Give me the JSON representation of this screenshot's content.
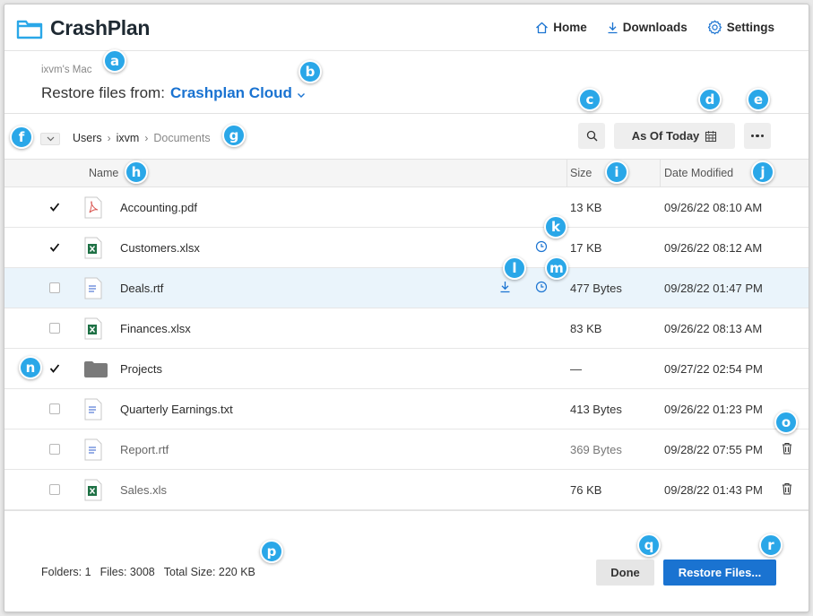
{
  "app": {
    "name": "CrashPlan"
  },
  "nav": [
    {
      "label": "Home",
      "icon": "home-icon"
    },
    {
      "label": "Downloads",
      "icon": "download-icon"
    },
    {
      "label": "Settings",
      "icon": "gear-icon"
    }
  ],
  "restore": {
    "device": "ixvm's Mac",
    "prefix": "Restore files from:",
    "source": "Crashplan Cloud"
  },
  "breadcrumb": {
    "items": [
      "Users",
      "ixvm"
    ],
    "current": "Documents"
  },
  "toolbar": {
    "as_of_label": "As Of Today"
  },
  "table": {
    "headers": {
      "name": "Name",
      "size": "Size",
      "date": "Date Modified"
    },
    "rows": [
      {
        "name": "Accounting.pdf",
        "size": "13 KB",
        "date": "09/26/22 08:10 AM",
        "type": "pdf",
        "checked": true
      },
      {
        "name": "Customers.xlsx",
        "size": "17 KB",
        "date": "09/26/22 08:12 AM",
        "type": "xlsx",
        "checked": true
      },
      {
        "name": "Deals.rtf",
        "size": "477 Bytes",
        "date": "09/28/22 01:47 PM",
        "type": "doc",
        "checked": false
      },
      {
        "name": "Finances.xlsx",
        "size": "83 KB",
        "date": "09/26/22 08:13 AM",
        "type": "xlsx",
        "checked": false
      },
      {
        "name": "Projects",
        "size": "—",
        "date": "09/27/22 02:54 PM",
        "type": "folder",
        "checked": true
      },
      {
        "name": "Quarterly Earnings.txt",
        "size": "413 Bytes",
        "date": "09/26/22 01:23 PM",
        "type": "doc",
        "checked": false
      },
      {
        "name": "Report.rtf",
        "size": "369 Bytes",
        "date": "09/28/22 07:55 PM",
        "type": "doc",
        "checked": false
      },
      {
        "name": "Sales.xls",
        "size": "76 KB",
        "date": "09/28/22 01:43 PM",
        "type": "xlsx",
        "checked": false
      }
    ]
  },
  "footer": {
    "folders": "Folders: 1",
    "files": "Files: 3008",
    "total": "Total Size: 220 KB",
    "done_label": "Done",
    "restore_label": "Restore Files..."
  },
  "callouts": {
    "a": "a",
    "b": "b",
    "c": "c",
    "d": "d",
    "e": "e",
    "f": "f",
    "g": "g",
    "h": "h",
    "i": "i",
    "j": "j",
    "k": "k",
    "l": "l",
    "m": "m",
    "n": "n",
    "o": "o",
    "p": "p",
    "q": "q",
    "r": "r"
  },
  "colors": {
    "accent": "#1a73d1",
    "callout": "#2aa7e8",
    "row_highlight": "#eaf4fb",
    "excel": "#1e7145",
    "pdf": "#d9534f"
  }
}
